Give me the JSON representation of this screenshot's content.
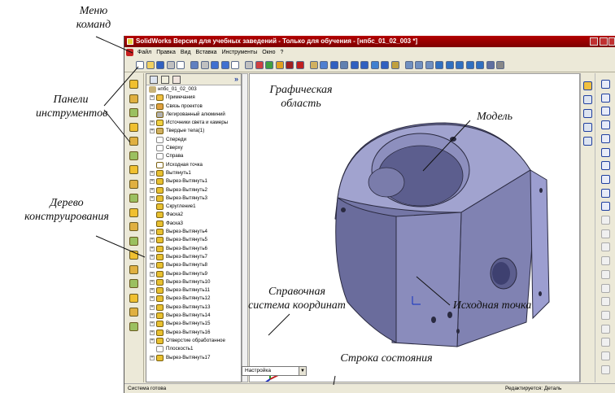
{
  "window": {
    "title": "SolidWorks Версия для учебных заведений - Только для обучения - [нпбс_01_02_003 *]"
  },
  "menu": {
    "items": [
      "Файл",
      "Правка",
      "Вид",
      "Вставка",
      "Инструменты",
      "Окно",
      "?"
    ]
  },
  "tree": {
    "root": "нпбс_01_02_003",
    "items": [
      {
        "label": "Примечания",
        "exp": true,
        "icon": "annotations-icon"
      },
      {
        "label": "Связь проектов",
        "exp": true,
        "icon": "design-binder-icon"
      },
      {
        "label": "Легированный алюминий",
        "exp": false,
        "icon": "material-icon"
      },
      {
        "label": "Источники света и камеры",
        "exp": true,
        "icon": "lights-icon"
      },
      {
        "label": "Твердые тела(1)",
        "exp": true,
        "icon": "solid-bodies-icon"
      },
      {
        "label": "Спереди",
        "exp": false,
        "icon": "plane-icon"
      },
      {
        "label": "Сверху",
        "exp": false,
        "icon": "plane-icon"
      },
      {
        "label": "Справа",
        "exp": false,
        "icon": "plane-icon"
      },
      {
        "label": "Исходная точка",
        "exp": false,
        "icon": "origin-icon"
      },
      {
        "label": "Вытянуть1",
        "exp": true,
        "icon": "extrude-icon"
      },
      {
        "label": "Вырез-Вытянуть1",
        "exp": true,
        "icon": "cut-extrude-icon"
      },
      {
        "label": "Вырез-Вытянуть2",
        "exp": true,
        "icon": "cut-extrude-icon"
      },
      {
        "label": "Вырез-Вытянуть3",
        "exp": true,
        "icon": "cut-extrude-icon"
      },
      {
        "label": "Скругление1",
        "exp": false,
        "icon": "fillet-icon"
      },
      {
        "label": "Фаска2",
        "exp": false,
        "icon": "chamfer-icon"
      },
      {
        "label": "Фаска3",
        "exp": false,
        "icon": "chamfer-icon"
      },
      {
        "label": "Вырез-Вытянуть4",
        "exp": true,
        "icon": "cut-extrude-icon"
      },
      {
        "label": "Вырез-Вытянуть5",
        "exp": true,
        "icon": "cut-extrude-icon"
      },
      {
        "label": "Вырез-Вытянуть6",
        "exp": true,
        "icon": "cut-extrude-icon"
      },
      {
        "label": "Вырез-Вытянуть7",
        "exp": true,
        "icon": "cut-extrude-icon"
      },
      {
        "label": "Вырез-Вытянуть8",
        "exp": true,
        "icon": "cut-extrude-icon"
      },
      {
        "label": "Вырез-Вытянуть9",
        "exp": true,
        "icon": "cut-extrude-icon"
      },
      {
        "label": "Вырез-Вытянуть10",
        "exp": true,
        "icon": "cut-extrude-icon"
      },
      {
        "label": "Вырез-Вытянуть11",
        "exp": true,
        "icon": "cut-extrude-icon"
      },
      {
        "label": "Вырез-Вытянуть12",
        "exp": true,
        "icon": "cut-extrude-icon"
      },
      {
        "label": "Вырез-Вытянуть13",
        "exp": true,
        "icon": "cut-extrude-icon"
      },
      {
        "label": "Вырез-Вытянуть14",
        "exp": true,
        "icon": "cut-extrude-icon"
      },
      {
        "label": "Вырез-Вытянуть15",
        "exp": true,
        "icon": "cut-extrude-icon"
      },
      {
        "label": "Вырез-Вытянуть16",
        "exp": true,
        "icon": "cut-extrude-icon"
      },
      {
        "label": "Отверстие обработанное",
        "exp": true,
        "icon": "hole-icon"
      },
      {
        "label": "Плоскость1",
        "exp": false,
        "icon": "plane-icon"
      },
      {
        "label": "Вырез-Вытянуть17",
        "exp": true,
        "icon": "cut-extrude-icon"
      }
    ]
  },
  "dropdown": {
    "value": "Настройка"
  },
  "status": {
    "left": "Система готова",
    "right": "Редактируется: Деталь"
  },
  "annotations": {
    "menu": "Меню\nкоманд",
    "toolbars": "Панели\nинструментов",
    "tree": "Дерево\nконструирования",
    "graphics": "Графическая\nобласть",
    "model": "Модель",
    "refsys": "Справочная\nсистема координат",
    "origin": "Исходная точка",
    "statusbar": "Строка состояния"
  },
  "colors": {
    "title": "#9e0000",
    "model": "#7476a6",
    "selection": "#2040a0"
  }
}
